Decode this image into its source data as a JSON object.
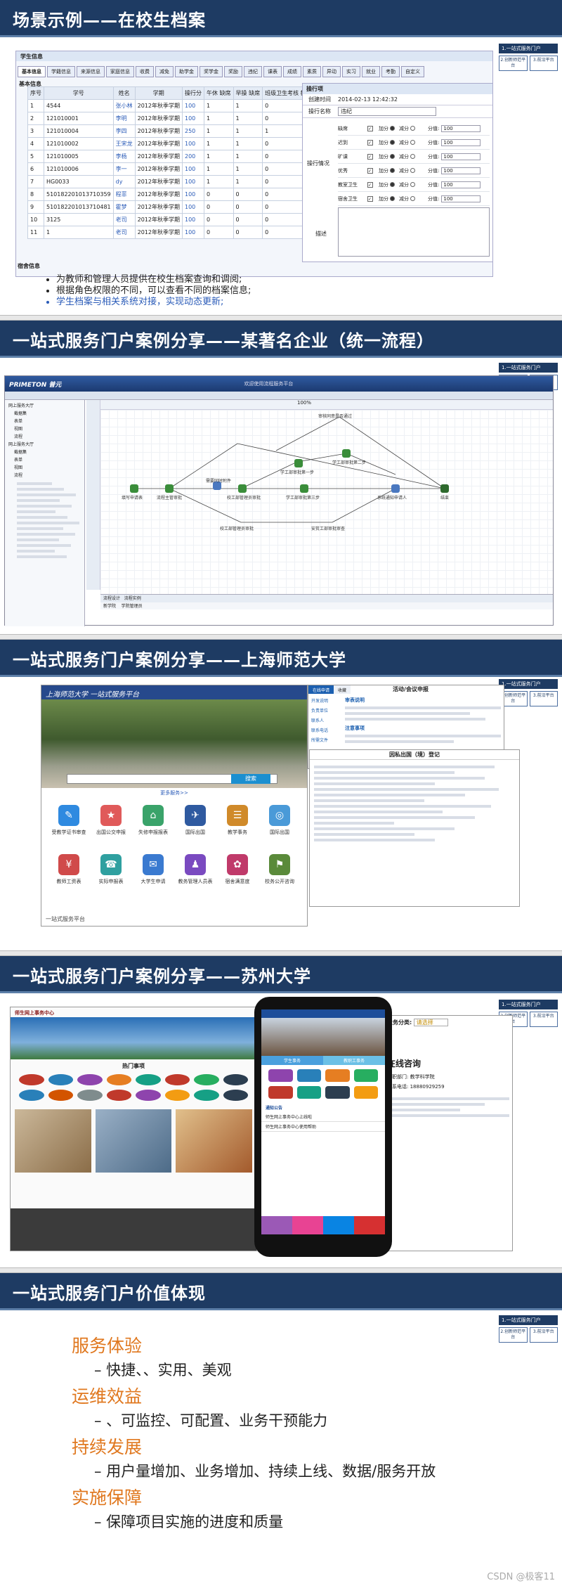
{
  "side_panel": {
    "title": "1.一站式服务门户",
    "btn_left": "2.创新师范平台",
    "btn_right": "3.前沿平台"
  },
  "slide1": {
    "title": "场景示例——在校生档案",
    "app_title": "学生信息",
    "tabs": [
      "基本信息",
      "学籍信息",
      "来源信息",
      "家庭信息",
      "收费",
      "减免",
      "助学金",
      "奖学金",
      "奖励",
      "违纪",
      "课表",
      "成绩",
      "素质",
      "异动",
      "实习",
      "就业",
      "考勤",
      "自定义"
    ],
    "section_label": "基本信息",
    "table_headers": [
      "序号",
      "学号",
      "姓名",
      "学期",
      "操行分",
      "午休 缺席",
      "早操 缺席",
      "班级卫生考核 教室卫生",
      "宿舍卫生",
      "违纪 宿舍记录"
    ],
    "rows": [
      [
        "1",
        "4544",
        "张小林",
        "2012年秋季学期",
        "100",
        "1",
        "1",
        "0",
        "",
        "0"
      ],
      [
        "2",
        "121010001",
        "李明",
        "2012年秋季学期",
        "100",
        "1",
        "1",
        "0",
        "",
        "0"
      ],
      [
        "3",
        "121010004",
        "李四",
        "2012年秋季学期",
        "250",
        "1",
        "1",
        "1",
        "",
        "1"
      ],
      [
        "4",
        "121010002",
        "王宋龙",
        "2012年秋季学期",
        "100",
        "1",
        "1",
        "0",
        "",
        "0"
      ],
      [
        "5",
        "121010005",
        "李杨",
        "2012年秋季学期",
        "200",
        "1",
        "1",
        "0",
        "",
        "0"
      ],
      [
        "6",
        "121010006",
        "李一",
        "2012年秋季学期",
        "100",
        "1",
        "1",
        "0",
        "",
        "0"
      ],
      [
        "7",
        "HG0033",
        "dy",
        "2012年秋季学期",
        "100",
        "1",
        "1",
        "0",
        "",
        "0"
      ],
      [
        "8",
        "510182201013710359",
        "程菲",
        "2012年秋季学期",
        "100",
        "0",
        "0",
        "0",
        "",
        "0"
      ],
      [
        "9",
        "510182201013710481",
        "霍梦",
        "2012年秋季学期",
        "100",
        "0",
        "0",
        "0",
        "",
        "0"
      ],
      [
        "10",
        "3125",
        "老司",
        "2012年秋季学期",
        "100",
        "0",
        "0",
        "0",
        "",
        "0"
      ],
      [
        "11",
        "1",
        "老司",
        "2012年秋季学期",
        "100",
        "0",
        "0",
        "0",
        "",
        "0"
      ]
    ],
    "dorm_label": "宿舍信息",
    "form": {
      "title": "操行项",
      "created_label": "创建时间",
      "created_value": "2014-02-13 12:42:32",
      "item_name_label": "操行名称",
      "item_name_value": "违纪",
      "rule_label": "操行情况",
      "rules": [
        "缺席",
        "迟到",
        "旷课",
        "优秀",
        "教室卫生",
        "宿舍卫生"
      ],
      "plus": "加分",
      "minus": "减分",
      "score_label": "分值:",
      "score_value": "100",
      "desc_label": "描述"
    },
    "bullets": [
      "为教师和管理人员提供在校生档案查询和调阅;",
      "根据角色权限的不同，可以查看不同的档案信息;",
      "学生档案与相关系统对接，实现动态更新;"
    ]
  },
  "slide2": {
    "title": "一站式服务门户案例分享——某著名企业（统一流程）",
    "app_name": "PRIMETON 普元",
    "banner_text": "欢迎使用流程服务平台",
    "tabs": [
      "流程设计",
      "流程实例"
    ],
    "tree": [
      "网上服务大厅",
      "截据集",
      "表单",
      "视图",
      "流程",
      "网上服务大厅",
      "截据集",
      "表单",
      "视图",
      "流程"
    ],
    "flow_nodes": [
      "填写申请表",
      "流程主管审批",
      "需要同时附件",
      "校工部管理员审批",
      "学工部审批第一步",
      "学工部审批第二步",
      "学工部审批第三步",
      "系统通知申请人",
      "结束",
      "审核同意是否通过",
      "安贫工部审批审查"
    ],
    "list_items": [
      "新学院",
      "学院管理员"
    ],
    "zoom": "100%"
  },
  "slide3": {
    "title": "一站式服务门户案例分享——上海师范大学",
    "portal_title": "上海师范大学 一站式服务平台",
    "search_btn": "搜索",
    "more_link": "更多服务>>",
    "icons": [
      "受教学证书审查",
      "出国公交申报",
      "失修申报报表",
      "国际出国",
      "教学事务",
      "国际出国",
      "教师工资表",
      "实际申报表",
      "大学生申请",
      "教务管理人员表",
      "宿舍满意度",
      "校务公开咨询"
    ],
    "footer": "一站式服务平台",
    "panel_tabs": [
      "在线申请",
      "收藏"
    ],
    "panel_title": "活动/会议申报",
    "panel_sections": [
      "审表说明",
      "注意事项"
    ],
    "links": [
      "开发说明",
      "负责单位",
      "联系人",
      "联系电话",
      "所需文件"
    ],
    "form_title": "因私出国（境）登记"
  },
  "slide4": {
    "title": "一站式服务门户案例分享——苏州大学",
    "portal_title": "师生网上事务中心",
    "hot_label": "热门事项",
    "phone_menu": [
      "学生事务",
      "教职工事务"
    ],
    "phone_notice": "通知公告",
    "phone_items": [
      "师生网上事务中心上线啦",
      "师生网上事务中心使用帮助"
    ],
    "right_label": "业务分类:",
    "right_select": "请选择",
    "consult": "在线咨询",
    "consult_dept_label": "校职部门:",
    "consult_dept": "教学科学院",
    "phone_label": "联系电话:",
    "phone_value": "18880929259"
  },
  "slide5": {
    "title": "一站式服务门户价值体现",
    "items": [
      {
        "head": "服务体验",
        "sub": "– 快捷、、实用、美观"
      },
      {
        "head": "运维效益",
        "sub": "– 、可监控、可配置、业务干预能力"
      },
      {
        "head": "持续发展",
        "sub": "– 用户量增加、业务增加、持续上线、数据/服务开放"
      },
      {
        "head": "实施保障",
        "sub": "– 保障项目实施的进度和质量"
      }
    ]
  },
  "watermark": "CSDN @极客11",
  "colors": {
    "header": "#1e3b63",
    "accent": "#e0781f",
    "link_blue": "#2a5bb8"
  }
}
